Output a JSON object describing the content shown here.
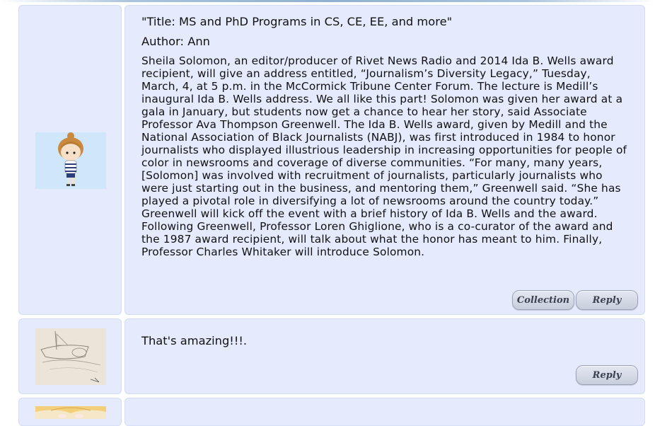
{
  "posts": [
    {
      "title": "\"Title: MS and PhD Programs in CS, CE, EE, and more\"",
      "author": "Author: Ann",
      "body": "Sheila Solomon, an editor/producer of Rivet News Radio and 2014 Ida B. Wells award recipient, will give an address entitled, “Journalism’s Diversity Legacy,” Tuesday, March, 4, at 5 p.m. in the McCormick Tribune Center Forum. The lecture is Medill’s inaugural Ida B. Wells address. We all like this part! Solomon was given her award at a gala in January, but students now get a chance to hear her story, said Associate Professor Ava Thompson Greenwell. The Ida B. Wells award, given by Medill and the National Association of Black Journalists (NABJ), was first introduced in 1984 to honor journalists who displayed illustrious leadership in increasing opportunities for people of color in newsrooms and coverage of diverse communities. “For many, many years, [Solomon] was involved with recruitment of journalists, particularly journalists who were just starting out in the business, and mentoring them,” Greenwell said. “She has played a pivotal role in diversifying a lot of newsrooms around the country today.” Greenwell will kick off the event with a brief history of Ida B. Wells and the award. Following Greenwell, Professor Loren Ghiglione, who is a co-curator of the award and the 1987 award recipient, will talk about what the honor has meant to him. Finally, Professor Charles Whitaker will introduce Solomon.",
      "collection_label": "Collection",
      "reply_label": "Reply"
    },
    {
      "body": "That's amazing!!!.",
      "reply_label": "Reply"
    }
  ],
  "colors": {
    "panel_bg": "#e5ebfd",
    "button_bg": "#d6dbe7",
    "text": "#111111"
  }
}
